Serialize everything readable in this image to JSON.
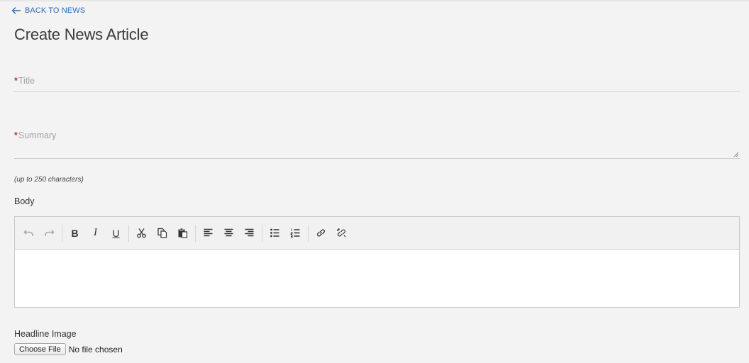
{
  "nav": {
    "back_label": "BACK TO NEWS",
    "back_icon": "arrow-left-icon"
  },
  "page": {
    "title": "Create News Article"
  },
  "form": {
    "title_field": {
      "required_mark": "*",
      "placeholder": "Title",
      "value": ""
    },
    "summary_field": {
      "required_mark": "*",
      "placeholder": "Summary",
      "value": "",
      "hint": "(up to 250 characters)"
    },
    "body": {
      "label": "Body",
      "content": "",
      "toolbar": [
        {
          "group": "history",
          "items": [
            {
              "name": "undo-icon",
              "enabled": false
            },
            {
              "name": "redo-icon",
              "enabled": false
            }
          ]
        },
        {
          "group": "format",
          "items": [
            {
              "name": "bold-icon",
              "glyph": "B"
            },
            {
              "name": "italic-icon",
              "glyph": "I"
            },
            {
              "name": "underline-icon",
              "glyph": "U"
            }
          ]
        },
        {
          "group": "clipboard",
          "items": [
            {
              "name": "cut-icon"
            },
            {
              "name": "copy-icon"
            },
            {
              "name": "paste-icon"
            }
          ]
        },
        {
          "group": "align",
          "items": [
            {
              "name": "align-left-icon"
            },
            {
              "name": "align-center-icon"
            },
            {
              "name": "align-right-icon"
            }
          ]
        },
        {
          "group": "lists",
          "items": [
            {
              "name": "bullet-list-icon"
            },
            {
              "name": "numbered-list-icon"
            }
          ]
        },
        {
          "group": "links",
          "items": [
            {
              "name": "link-icon"
            },
            {
              "name": "unlink-icon"
            }
          ]
        }
      ]
    },
    "headline_image": {
      "label": "Headline Image",
      "button_label": "Choose File",
      "status": "No file chosen"
    }
  },
  "colors": {
    "link": "#2f6ab5",
    "required": "#c0392b",
    "background": "#f3f3f3"
  }
}
